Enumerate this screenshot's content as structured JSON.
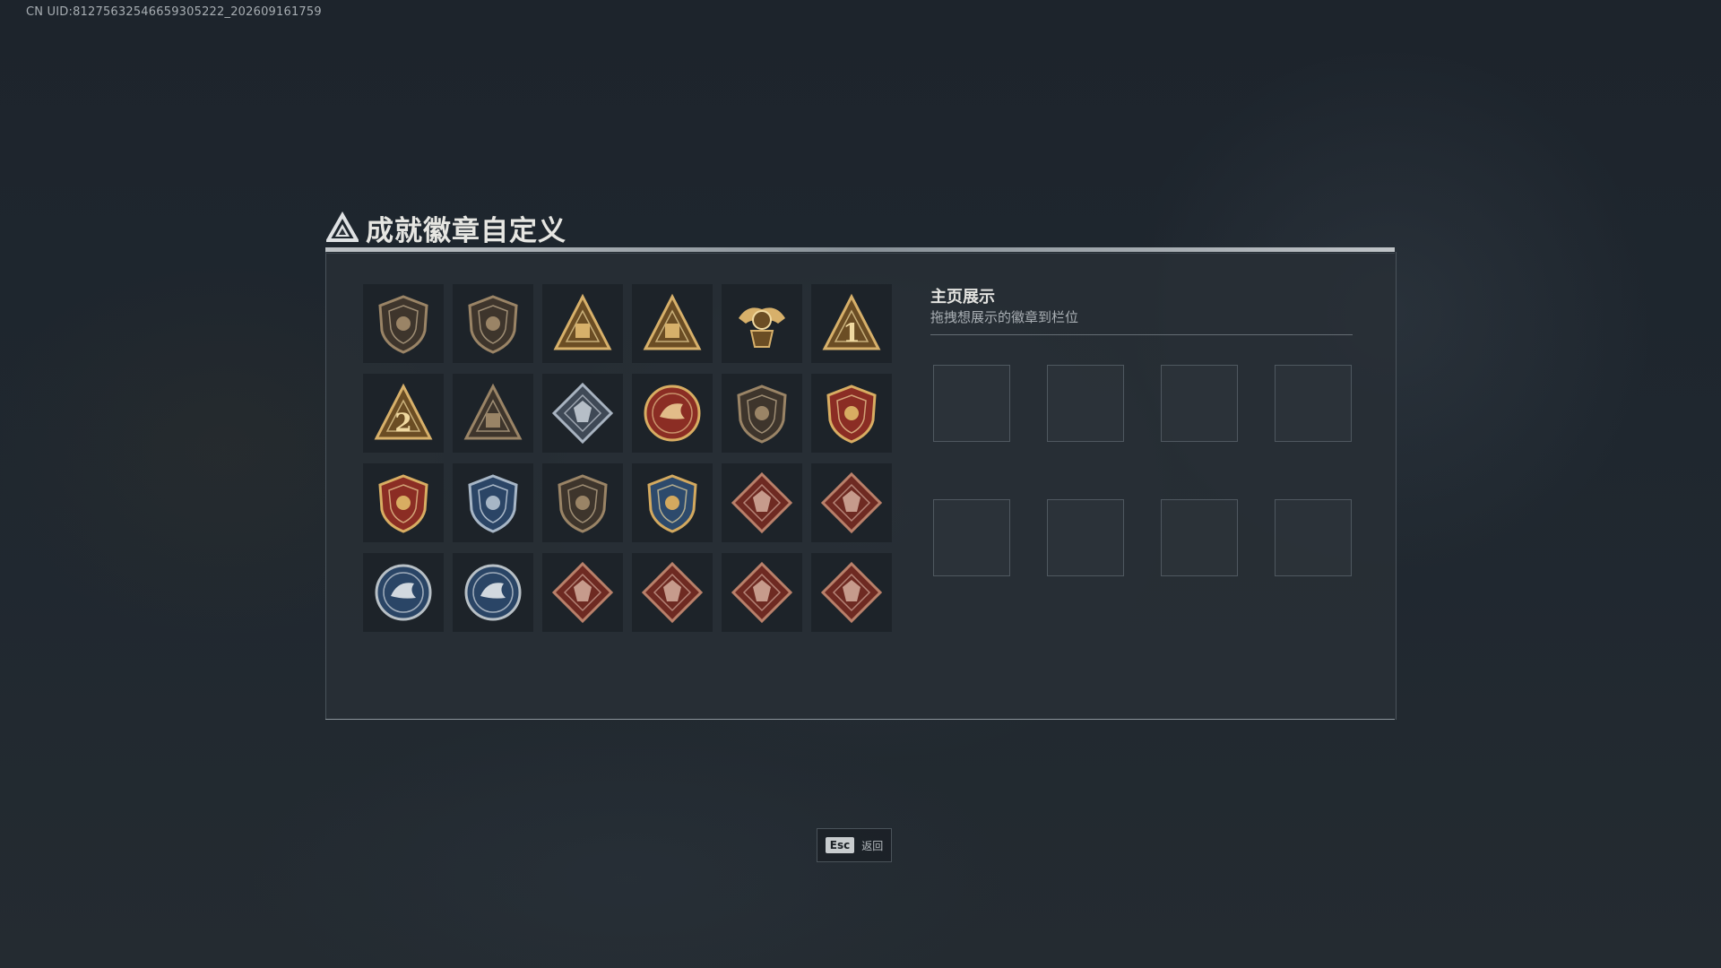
{
  "uid_text": "CN UID:81275632546659305222_202609161759",
  "title": "成就徽章自定义",
  "title_icon": "triangle-emblem-icon",
  "showcase": {
    "title": "主页展示",
    "subtitle": "拖拽想展示的徽章到栏位",
    "slot_count": 8
  },
  "badges": [
    {
      "name": "triangle-shield-badge",
      "shape": "shield",
      "tier": "bronze"
    },
    {
      "name": "helicopter-shield-badge",
      "shape": "shield",
      "tier": "bronze"
    },
    {
      "name": "tower-triangle-badge",
      "shape": "triangle",
      "tier": "gold"
    },
    {
      "name": "vehicle-triangle-badge",
      "shape": "triangle",
      "tier": "gold"
    },
    {
      "name": "eagle-crest-badge",
      "shape": "crest",
      "tier": "gold"
    },
    {
      "name": "rank-one-triangle-badge",
      "shape": "triangle",
      "tier": "gold",
      "numeral": "1"
    },
    {
      "name": "rank-two-triangle-badge",
      "shape": "triangle",
      "tier": "gold",
      "numeral": "2"
    },
    {
      "name": "soldiers-triangle-badge",
      "shape": "triangle",
      "tier": "bronze"
    },
    {
      "name": "cube-diamond-badge",
      "shape": "diamond",
      "tier": "silver"
    },
    {
      "name": "star-medal-badge",
      "shape": "round",
      "tier": "gold-red"
    },
    {
      "name": "insignia-shield-badge",
      "shape": "shield",
      "tier": "bronze"
    },
    {
      "name": "winged-red-shield-badge",
      "shape": "shield",
      "tier": "gold-red"
    },
    {
      "name": "winged-emblem-badge",
      "shape": "shield",
      "tier": "gold-red"
    },
    {
      "name": "crosshair-blue-shield-badge",
      "shape": "shield",
      "tier": "silver-blue"
    },
    {
      "name": "rifle-shield-badge",
      "shape": "shield",
      "tier": "bronze"
    },
    {
      "name": "crosshair-gold-shield-badge",
      "shape": "shield",
      "tier": "gold-blue"
    },
    {
      "name": "wolf-diamond-badge-1",
      "shape": "diamond",
      "tier": "red"
    },
    {
      "name": "wolf-diamond-badge-2",
      "shape": "diamond",
      "tier": "red"
    },
    {
      "name": "eagle-round-badge-1",
      "shape": "round",
      "tier": "blue"
    },
    {
      "name": "eagle-round-badge-2",
      "shape": "round",
      "tier": "blue"
    },
    {
      "name": "dragon-diamond-badge",
      "shape": "diamond",
      "tier": "red"
    },
    {
      "name": "bear-diamond-badge",
      "shape": "diamond",
      "tier": "red"
    },
    {
      "name": "lion-diamond-badge",
      "shape": "diamond",
      "tier": "red"
    },
    {
      "name": "serpent-diamond-badge",
      "shape": "diamond",
      "tier": "red"
    }
  ],
  "esc_hint": {
    "key": "Esc",
    "label": "返回"
  },
  "colors": {
    "gold": "#c9a25a",
    "bronze": "#8a7860",
    "silver": "#8e9aa8",
    "red": "#7a2b22",
    "blue": "#2e4a6e"
  }
}
